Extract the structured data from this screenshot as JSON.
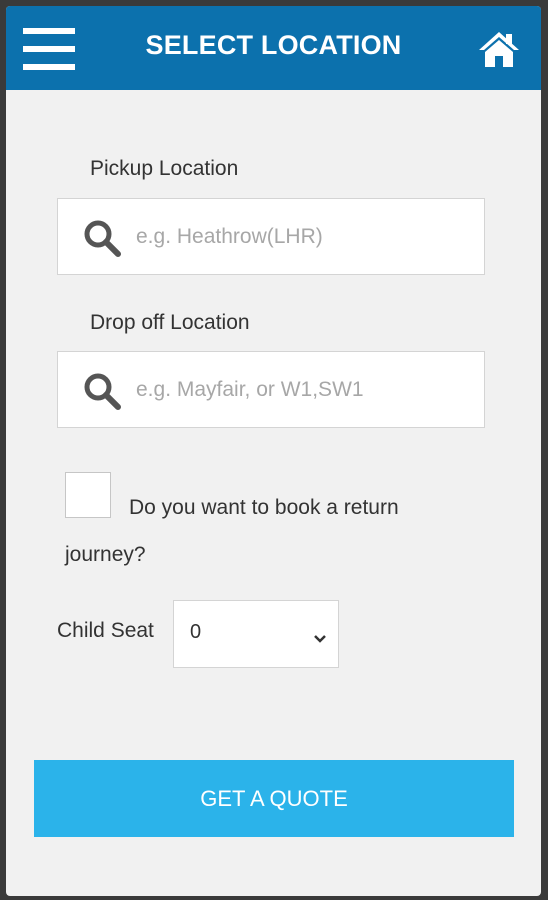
{
  "header": {
    "title": "SELECT LOCATION",
    "menu_icon": "hamburger-menu-icon",
    "home_icon": "home-icon",
    "background_color": "#0c71ad"
  },
  "pickup": {
    "label": "Pickup Location",
    "placeholder": "e.g. Heathrow(LHR)",
    "value": "",
    "icon": "search-icon"
  },
  "dropoff": {
    "label": "Drop off Location",
    "placeholder": "e.g. Mayfair, or W1,SW1",
    "value": "",
    "icon": "search-icon"
  },
  "return_journey": {
    "label": "Do you want to book a return journey?",
    "checked": false
  },
  "child_seat": {
    "label": "Child Seat",
    "selected": "0"
  },
  "quote_button": {
    "label": "GET A QUOTE",
    "color": "#2bb3ea"
  }
}
